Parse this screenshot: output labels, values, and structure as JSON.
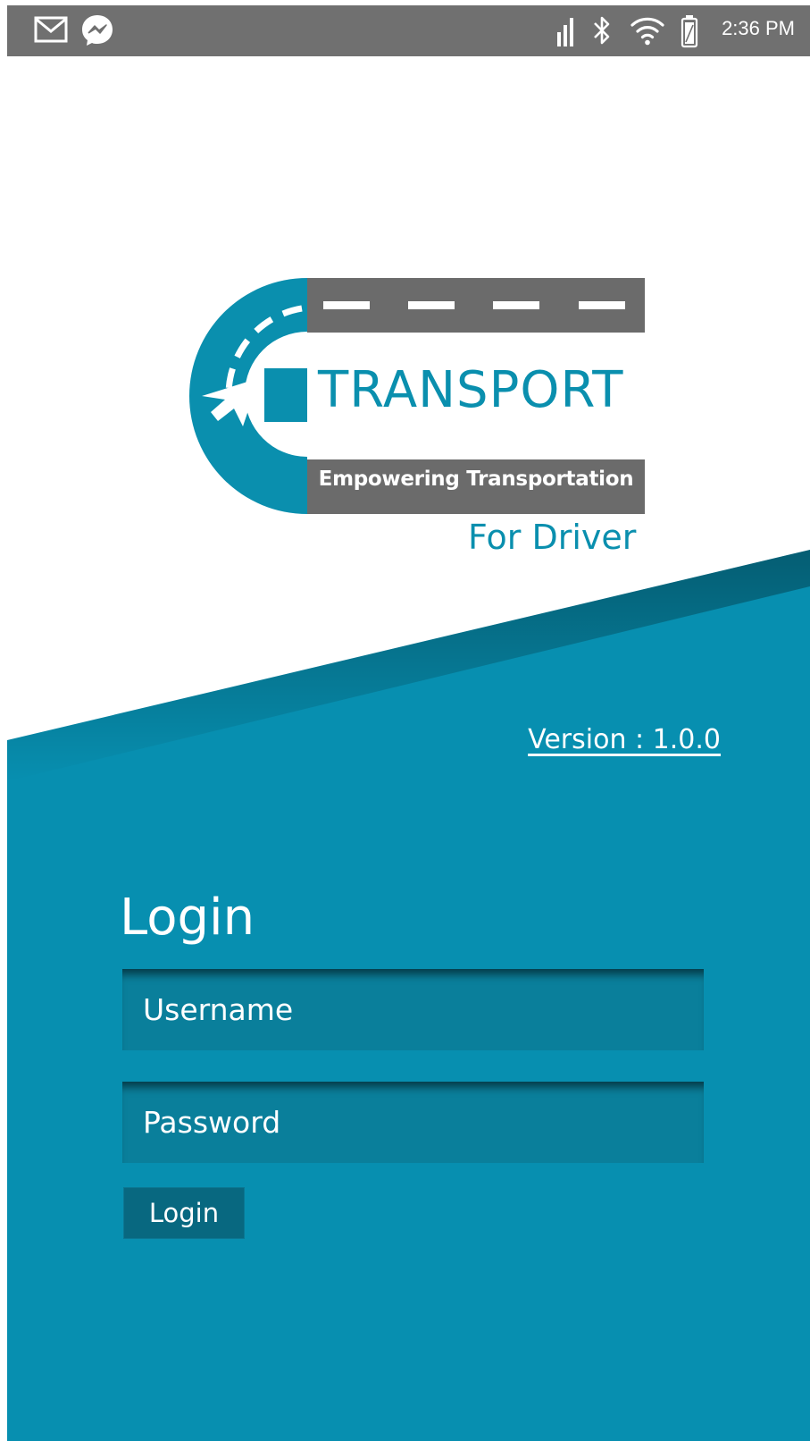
{
  "status_bar": {
    "time": "2:36 PM",
    "icons": [
      "mail-icon",
      "messenger-icon",
      "signal-icon",
      "bluetooth-icon",
      "wifi-icon",
      "battery-icon"
    ]
  },
  "logo": {
    "word": "TRANSPORT",
    "tagline": "Empowering Transportation"
  },
  "subtitle": "For Driver",
  "version_link": "Version : 1.0.0",
  "login": {
    "title": "Login",
    "username_placeholder": "Username",
    "password_placeholder": "Password",
    "button_label": "Login"
  },
  "colors": {
    "accent": "#078fb0",
    "status_bar": "#707070",
    "field_bg": "#0a7f9b",
    "button_bg": "#086880",
    "logo_gray": "#6b6b6b"
  }
}
